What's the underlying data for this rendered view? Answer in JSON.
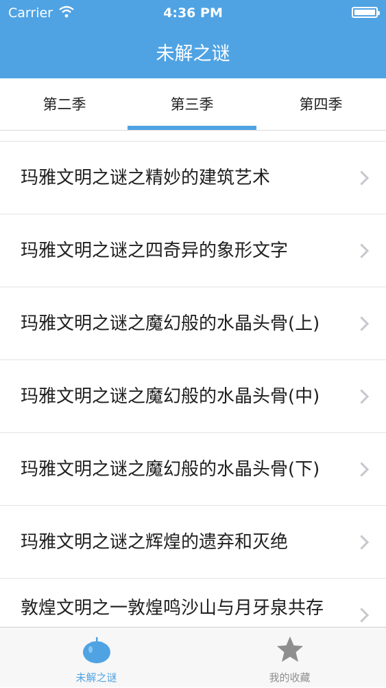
{
  "status_bar": {
    "carrier": "Carrier",
    "time": "4:36 PM"
  },
  "nav": {
    "title": "未解之谜"
  },
  "tabs": [
    {
      "label": "第二季"
    },
    {
      "label": "第三季",
      "selected": true
    },
    {
      "label": "第四季"
    }
  ],
  "list": {
    "items": [
      {
        "title": "玛雅文明之谜之精妙的建筑艺术"
      },
      {
        "title": "玛雅文明之谜之四奇异的象形文字"
      },
      {
        "title": "玛雅文明之谜之魔幻般的水晶头骨(上)"
      },
      {
        "title": "玛雅文明之谜之魔幻般的水晶头骨(中)"
      },
      {
        "title": "玛雅文明之谜之魔幻般的水晶头骨(下)"
      },
      {
        "title": "玛雅文明之谜之辉煌的遗弃和灭绝"
      },
      {
        "title": "敦煌文明之一敦煌鸣沙山与月牙泉共存之谜"
      }
    ]
  },
  "tab_bar": {
    "items": [
      {
        "label": "未解之谜",
        "icon": "tomato-icon",
        "selected": true
      },
      {
        "label": "我的收藏",
        "icon": "star-icon",
        "selected": false
      }
    ]
  },
  "colors": {
    "accent": "#4fa3e3",
    "tab_inactive": "#8e8e8e"
  }
}
